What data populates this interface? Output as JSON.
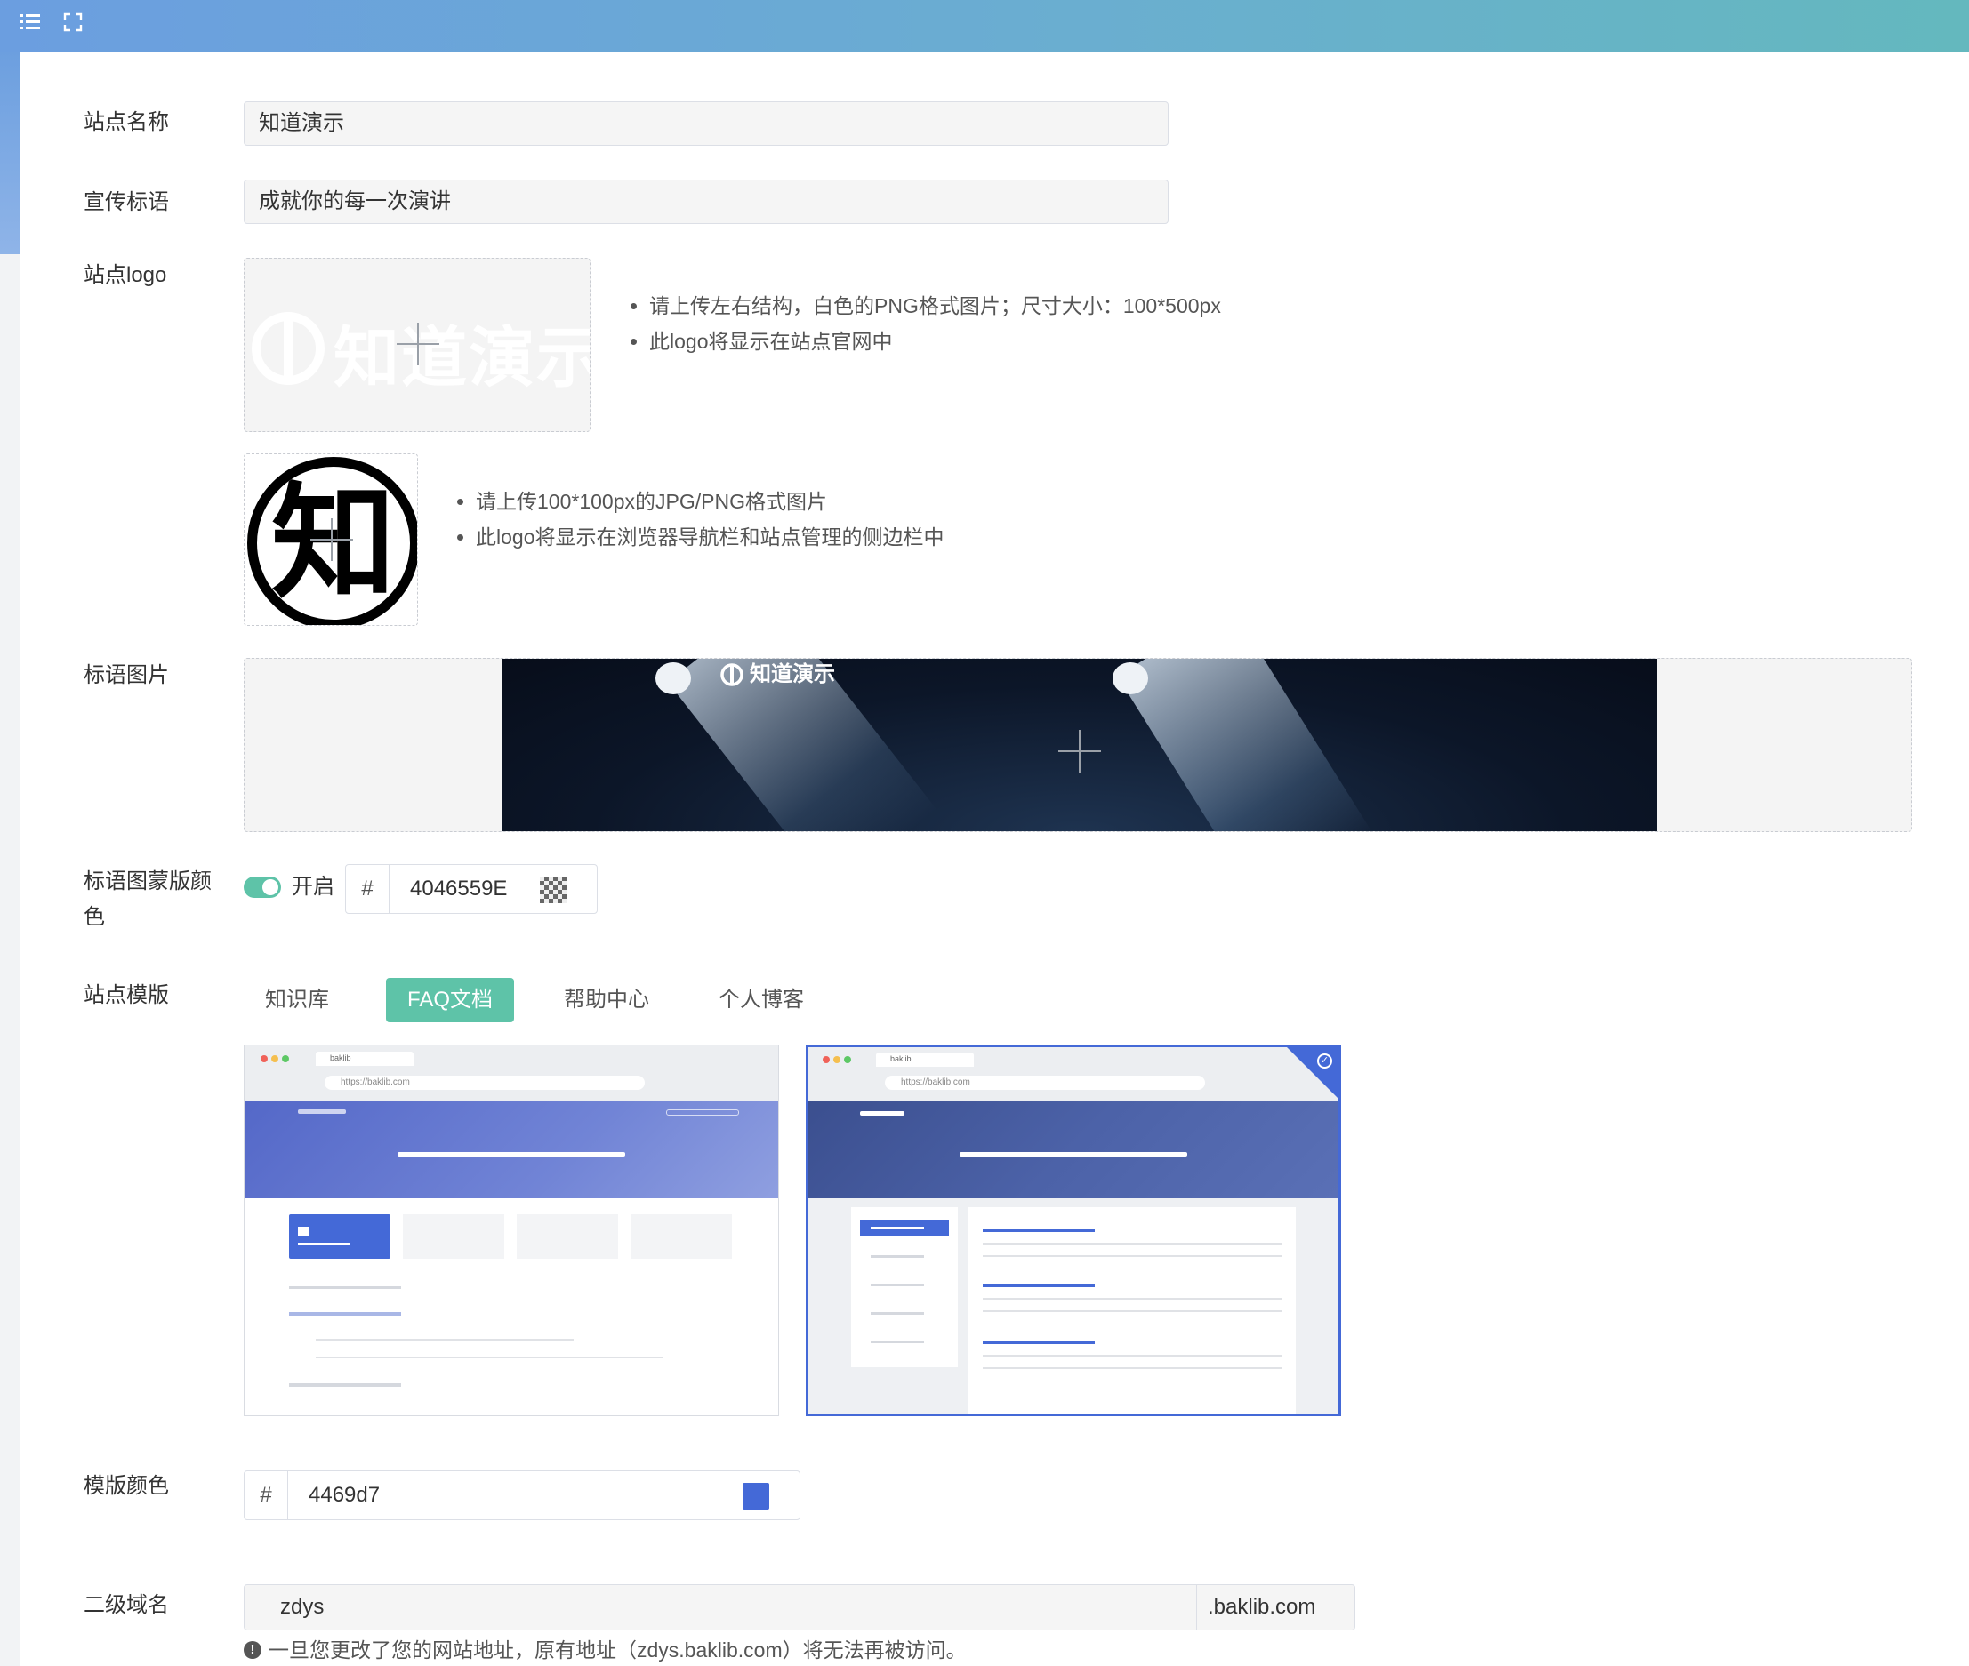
{
  "toolbar": {
    "menu_icon": "list-icon",
    "fullscreen_icon": "fullscreen-icon"
  },
  "fields": {
    "site_name": {
      "label": "站点名称",
      "value": "知道演示"
    },
    "slogan": {
      "label": "宣传标语",
      "value": "成就你的每一次演讲"
    },
    "site_logo": {
      "label": "站点logo",
      "logo_text": "知道演示",
      "hints": [
        "请上传左右结构，白色的PNG格式图片；尺寸大小：100*500px",
        "此logo将显示在站点官网中"
      ],
      "icon_char": "知",
      "icon_hints": [
        "请上传100*100px的JPG/PNG格式图片",
        "此logo将显示在浏览器导航栏和站点管理的侧边栏中"
      ]
    },
    "slogan_image": {
      "label": "标语图片",
      "banner_text": "知道演示"
    },
    "mask_color": {
      "label_line1": "标语图蒙版颜",
      "label_line2": "色",
      "toggle_label": "开启",
      "toggle_on": true,
      "hash": "#",
      "value": "4046559E"
    },
    "template": {
      "label": "站点模版",
      "tabs": [
        "知识库",
        "FAQ文档",
        "帮助中心",
        "个人博客"
      ],
      "active_tab": "FAQ文档",
      "preview_url": "https://baklib.com",
      "preview_brand": "baklib",
      "selected_index": 1
    },
    "template_color": {
      "label": "模版颜色",
      "hash": "#",
      "value": "4469d7",
      "swatch": "#4469d7"
    },
    "subdomain": {
      "label": "二级域名",
      "value": "zdys",
      "suffix": ".baklib.com",
      "warning": "一旦您更改了您的网站地址，原有地址（zdys.baklib.com）将无法再被访问。"
    }
  }
}
